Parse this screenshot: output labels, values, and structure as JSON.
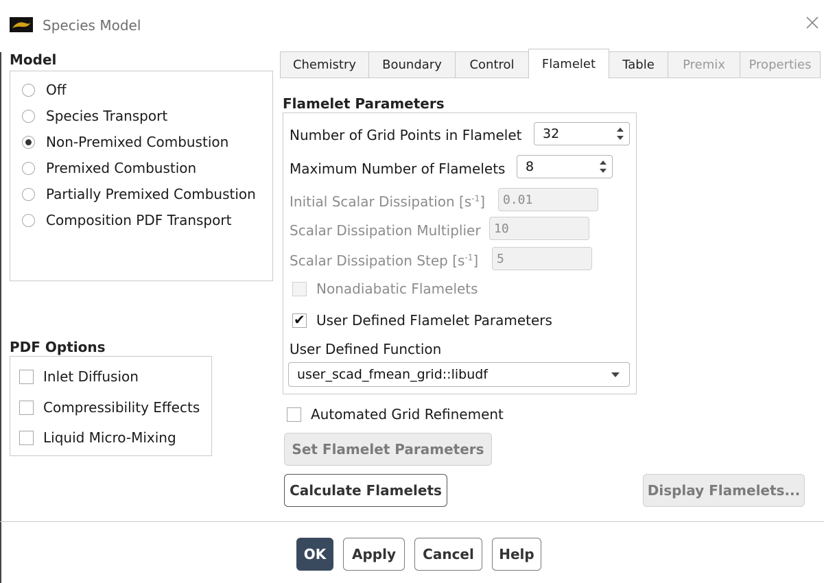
{
  "window": {
    "title": "Species Model"
  },
  "model": {
    "label": "Model",
    "options": [
      {
        "label": "Off",
        "selected": false
      },
      {
        "label": "Species Transport",
        "selected": false
      },
      {
        "label": "Non-Premixed Combustion",
        "selected": true
      },
      {
        "label": "Premixed Combustion",
        "selected": false
      },
      {
        "label": "Partially Premixed Combustion",
        "selected": false
      },
      {
        "label": "Composition PDF Transport",
        "selected": false
      }
    ]
  },
  "pdf_options": {
    "label": "PDF Options",
    "items": [
      {
        "label": "Inlet Diffusion",
        "checked": false
      },
      {
        "label": "Compressibility Effects",
        "checked": false
      },
      {
        "label": "Liquid Micro-Mixing",
        "checked": false
      }
    ]
  },
  "tabs": [
    {
      "label": "Chemistry",
      "state": "normal"
    },
    {
      "label": "Boundary",
      "state": "normal"
    },
    {
      "label": "Control",
      "state": "normal"
    },
    {
      "label": "Flamelet",
      "state": "active"
    },
    {
      "label": "Table",
      "state": "normal"
    },
    {
      "label": "Premix",
      "state": "disabled"
    },
    {
      "label": "Properties",
      "state": "disabled"
    }
  ],
  "flamelet": {
    "section_label": "Flamelet Parameters",
    "grid_points": {
      "label": "Number of Grid Points in Flamelet",
      "value": "32"
    },
    "max_flamelets": {
      "label": "Maximum Number of Flamelets",
      "value": "8"
    },
    "initial_dissipation": {
      "label": "Initial Scalar Dissipation [s",
      "unit_sup": "-1",
      "label_end": "]",
      "value": "0.01"
    },
    "dissipation_multiplier": {
      "label": "Scalar Dissipation Multiplier",
      "value": "10"
    },
    "dissipation_step": {
      "label": "Scalar Dissipation Step [s",
      "unit_sup": "-1",
      "label_end": "]",
      "value": "5"
    },
    "nonadiabatic": {
      "label": "Nonadiabatic Flamelets",
      "checked": false,
      "disabled": true
    },
    "user_defined_params": {
      "label": "User Defined Flamelet Parameters",
      "checked": true,
      "check_glyph": "✔"
    },
    "udf": {
      "label": "User Defined Function",
      "value": "user_scad_fmean_grid::libudf"
    },
    "automated_refinement": {
      "label": "Automated Grid Refinement",
      "checked": false
    },
    "set_params_button": "Set Flamelet Parameters",
    "calculate_button": "Calculate Flamelets",
    "display_button": "Display Flamelets..."
  },
  "footer": {
    "ok": "OK",
    "apply": "Apply",
    "cancel": "Cancel",
    "help": "Help"
  },
  "colors": {
    "primary_button": "#3a4a5e",
    "app_icon": "#d4a017"
  },
  "icons": {
    "close": "close-icon",
    "app": "app-icon"
  }
}
